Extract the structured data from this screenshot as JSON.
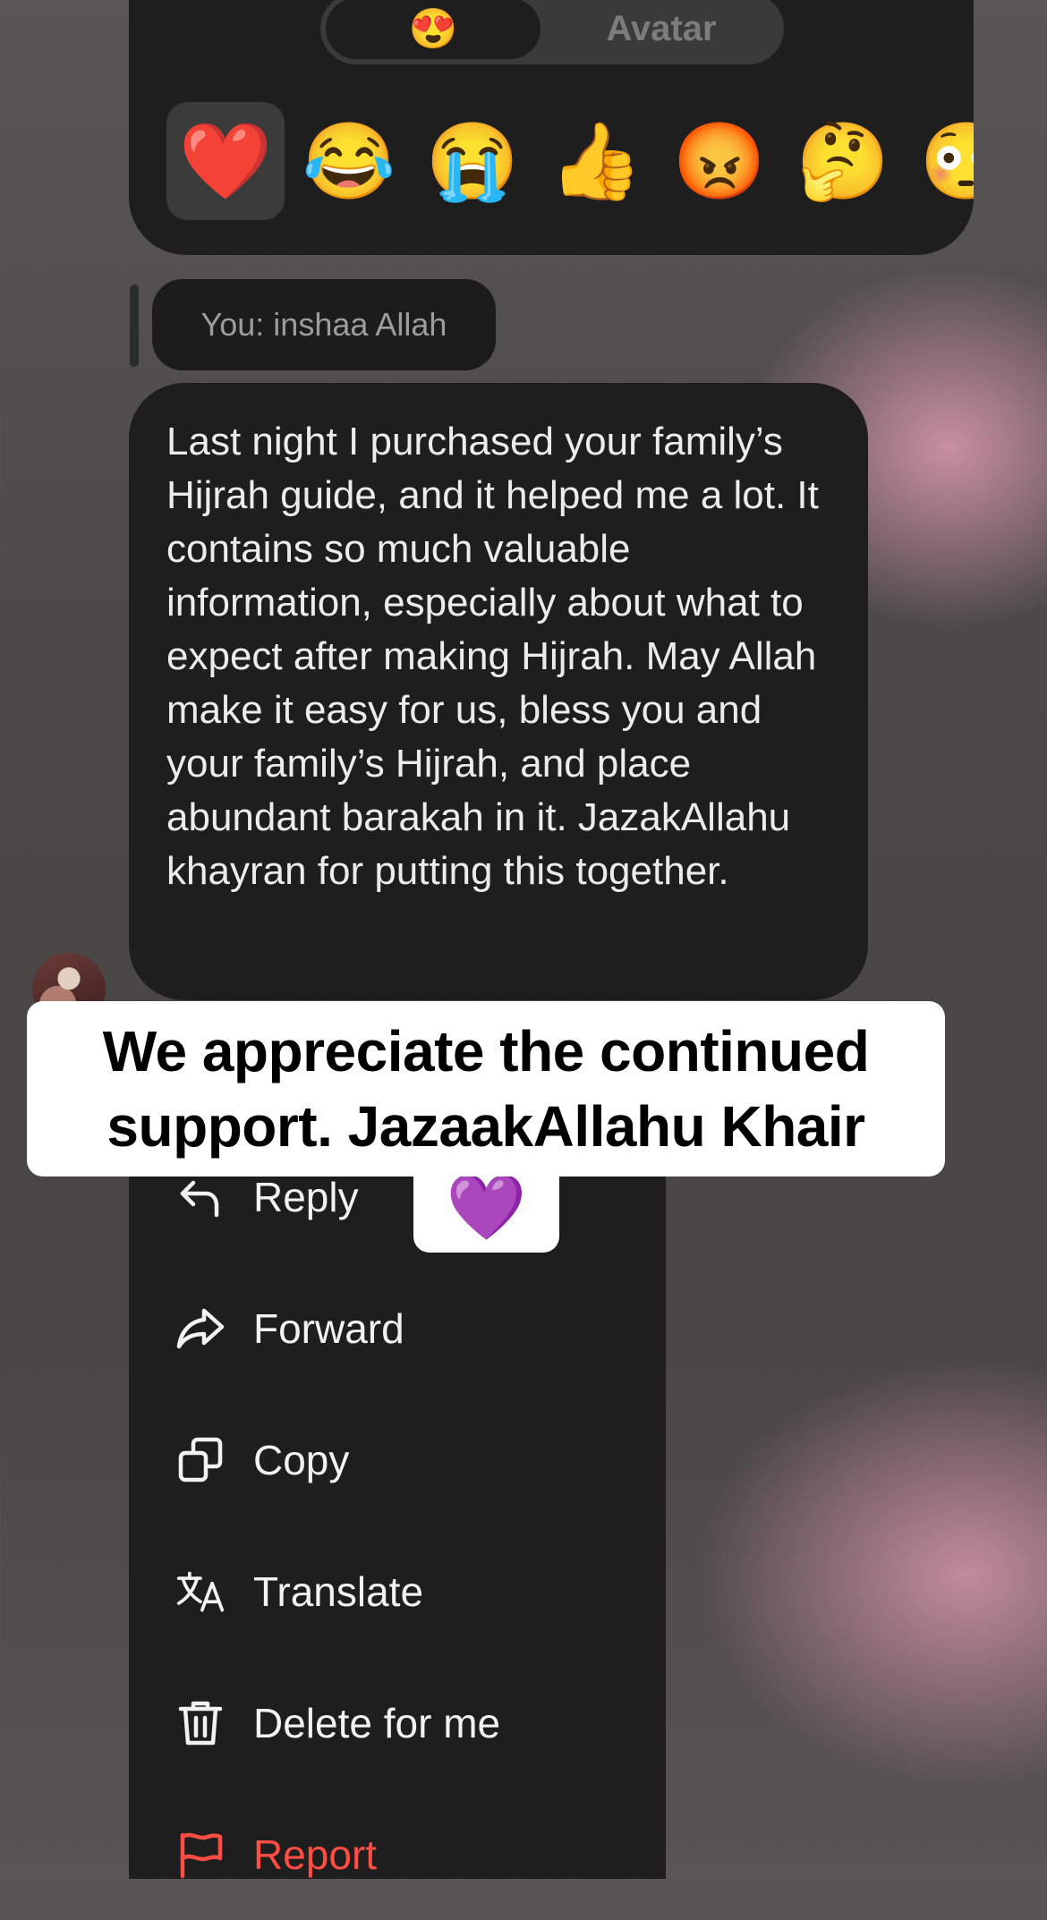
{
  "reaction_panel": {
    "tabs": [
      {
        "label": "😍",
        "selected": true
      },
      {
        "label": "Avatar",
        "selected": false
      }
    ],
    "emojis": [
      {
        "char": "❤️",
        "name": "red-heart",
        "selected": true
      },
      {
        "char": "😂",
        "name": "tears-of-joy"
      },
      {
        "char": "😭",
        "name": "loudly-crying"
      },
      {
        "char": "👍",
        "name": "thumbs-up"
      },
      {
        "char": "😡",
        "name": "angry-face"
      },
      {
        "char": "🤔",
        "name": "thinking-face"
      },
      {
        "char": "😳",
        "name": "flushed-face"
      }
    ]
  },
  "reply_preview": {
    "text": "You: inshaa Allah"
  },
  "message": {
    "text": "Last night I purchased your family’s Hijrah guide, and it helped me a lot. It contains so much valuable information, especially about what to expect after making Hijrah. May Allah make it easy for us, bless you and your family’s Hijrah, and place abundant barakah in it. JazakAllahu khayran for putting this together."
  },
  "caption": {
    "text": "We appreciate the continued support. JazaakAllahu Khair",
    "emoji": "💜"
  },
  "menu": {
    "items": [
      {
        "label": "Reply",
        "icon": "reply-icon"
      },
      {
        "label": "Forward",
        "icon": "forward-icon"
      },
      {
        "label": "Copy",
        "icon": "copy-icon"
      },
      {
        "label": "Translate",
        "icon": "translate-icon"
      },
      {
        "label": "Delete for me",
        "icon": "trash-icon"
      },
      {
        "label": "Report",
        "icon": "flag-icon",
        "color": "#ff4d44"
      }
    ]
  },
  "colors": {
    "panel": "#1e1e1e",
    "report": "#ff4d44",
    "caption_bg": "#ffffff"
  }
}
